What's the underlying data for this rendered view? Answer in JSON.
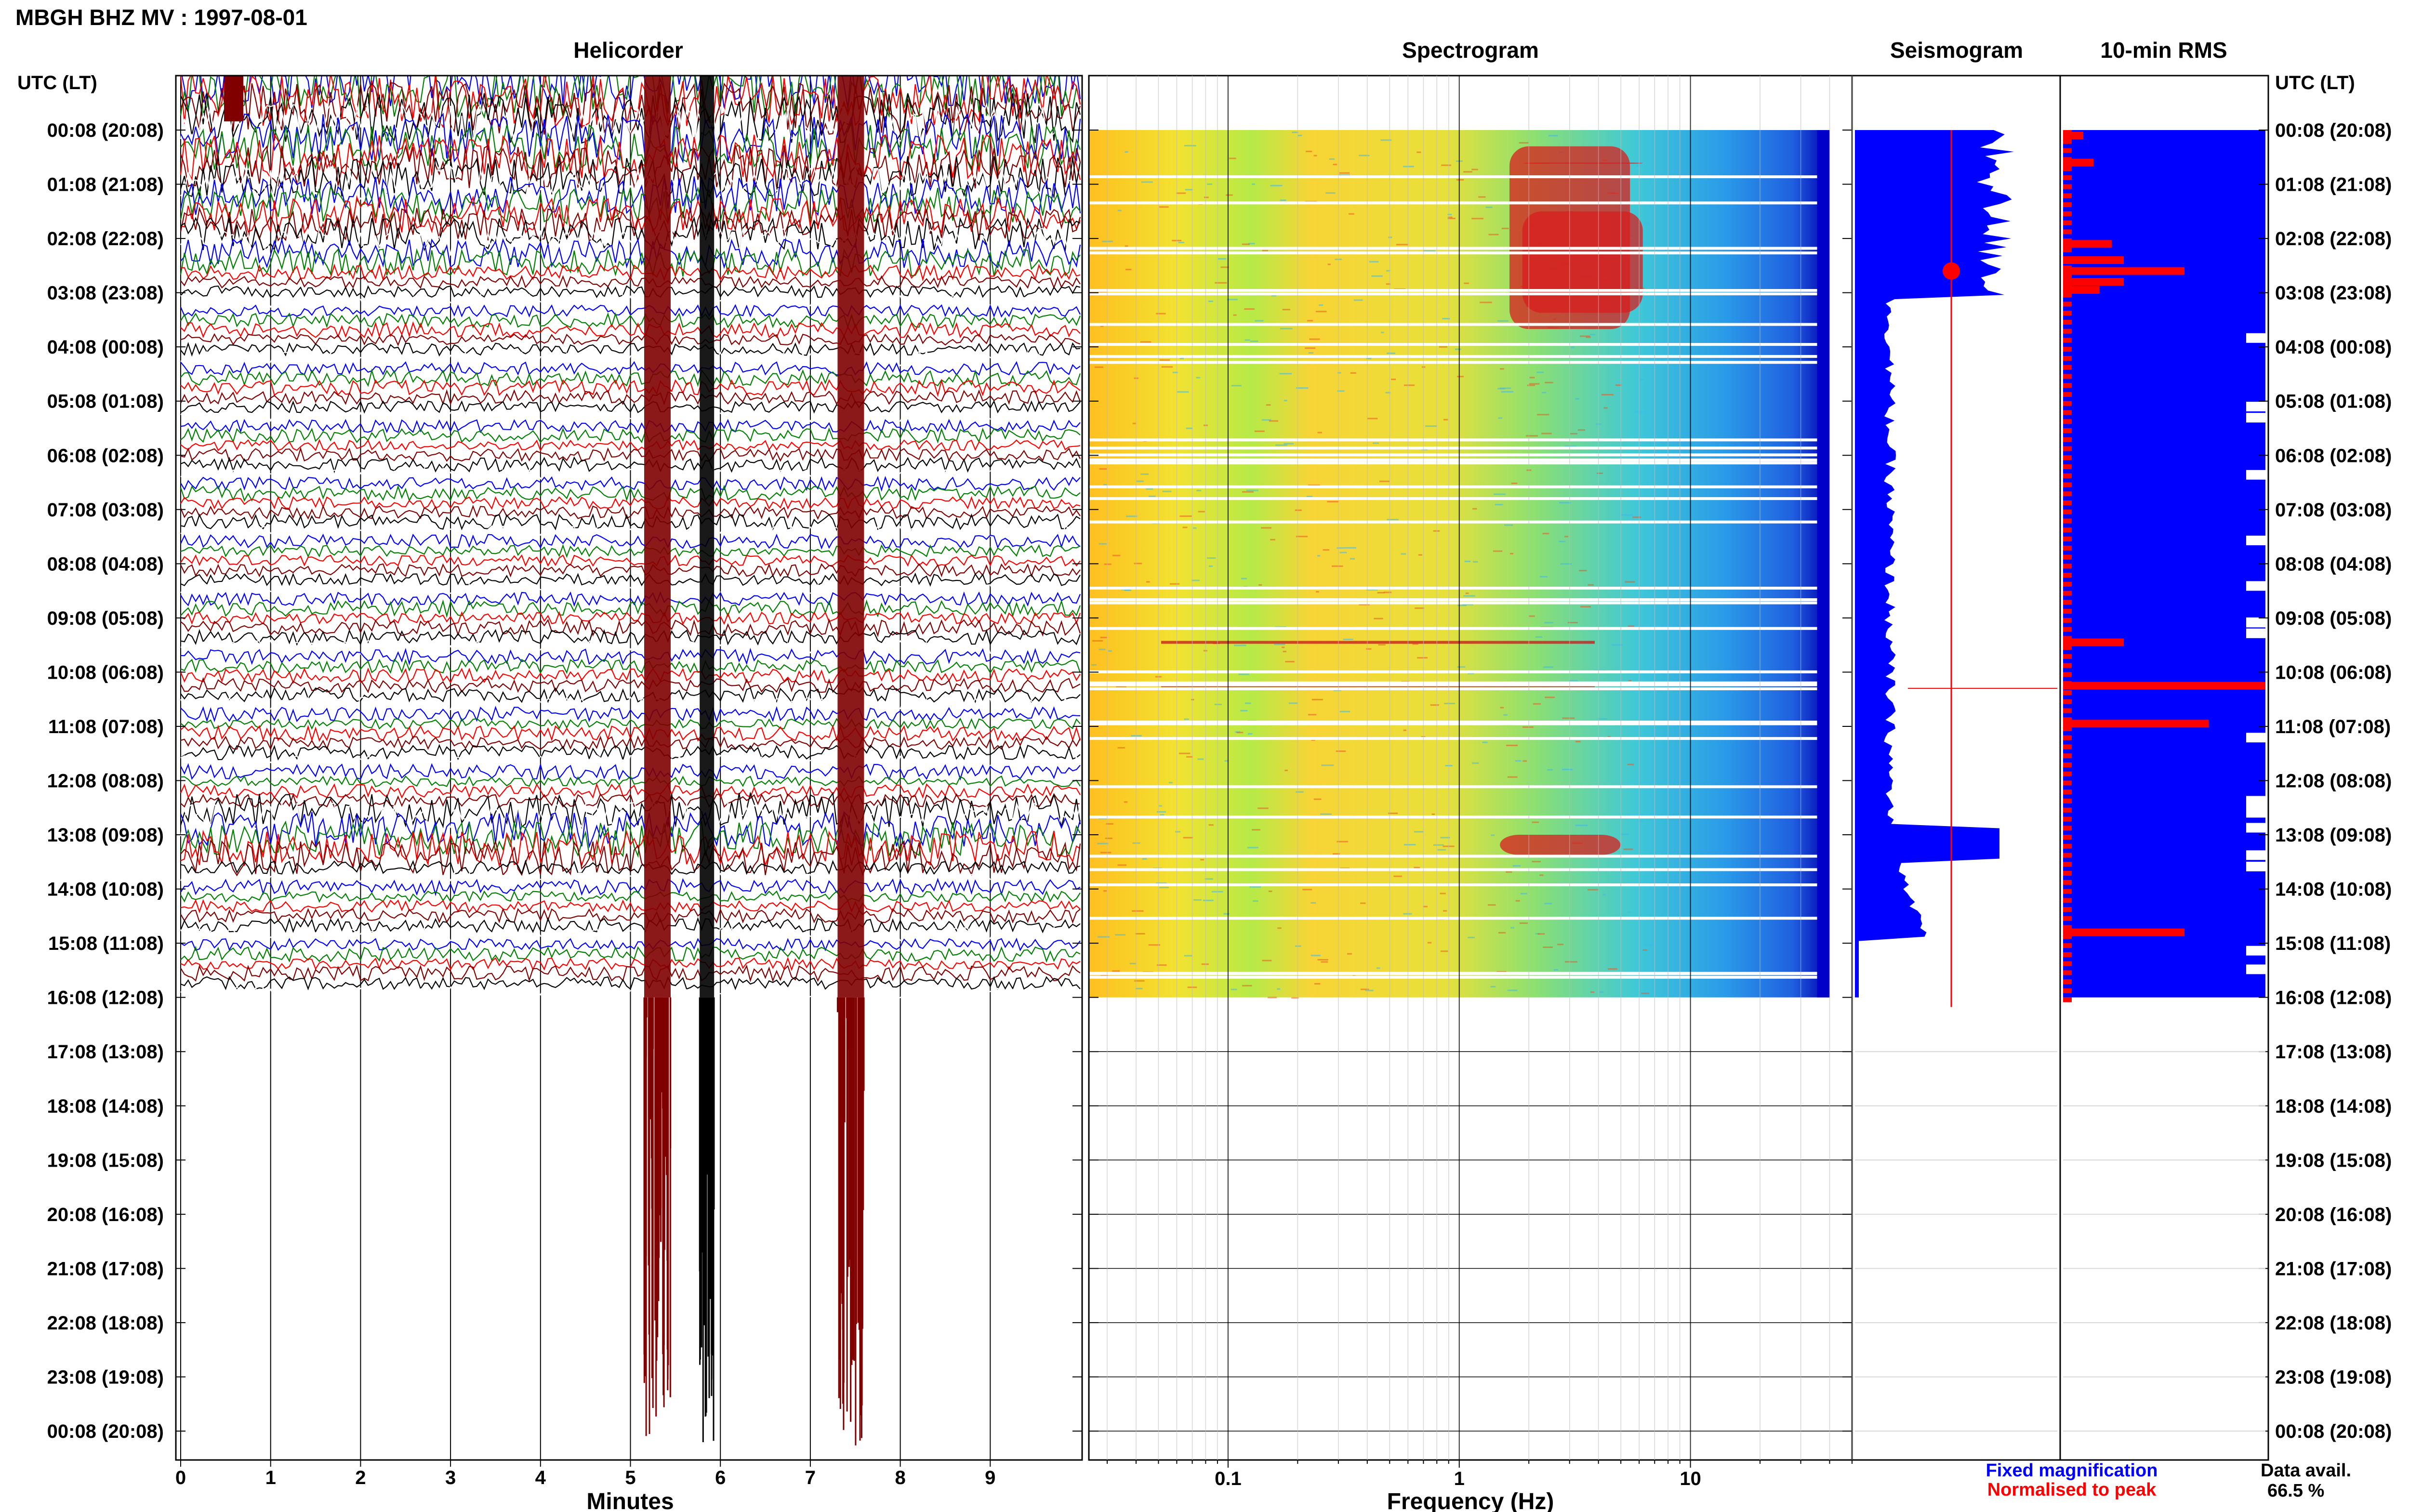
{
  "header": {
    "title": "MBGH BHZ MV : 1997-08-01",
    "time_axis_label": "UTC (LT)"
  },
  "panels": {
    "helicorder": "Helicorder",
    "spectrogram": "Spectrogram",
    "seismogram": "Seismogram",
    "rms": "10-min RMS"
  },
  "legend": {
    "fixed": "Fixed magnification",
    "normalised": "Normalised to peak",
    "fixed_color": "#0000ff",
    "normalised_color": "#ff0000",
    "data_avail_label": "Data avail.",
    "data_avail_value": "66.5 %"
  },
  "chart_data": {
    "type": "heatmap",
    "time_ticks": [
      "00:08 (20:08)",
      "01:08 (21:08)",
      "02:08 (22:08)",
      "03:08 (23:08)",
      "04:08 (00:08)",
      "05:08 (01:08)",
      "06:08 (02:08)",
      "07:08 (03:08)",
      "08:08 (04:08)",
      "09:08 (05:08)",
      "10:08 (06:08)",
      "11:08 (07:08)",
      "12:08 (08:08)",
      "13:08 (09:08)",
      "14:08 (10:08)",
      "15:08 (11:08)",
      "16:08 (12:08)",
      "17:08 (13:08)",
      "18:08 (14:08)",
      "19:08 (15:08)",
      "20:08 (16:08)",
      "21:08 (17:08)",
      "22:08 (18:08)",
      "23:08 (19:08)",
      "00:08 (20:08)"
    ],
    "data_end_hour": 16,
    "helicorder": {
      "xlabel": "Minutes",
      "xlim": [
        0,
        10
      ],
      "xticks": [
        0,
        1,
        2,
        3,
        4,
        5,
        6,
        7,
        8,
        9
      ],
      "trace_colors": [
        "#0000ff",
        "#007f00",
        "#ff0000",
        "#800000",
        "#000000",
        "#ffffff"
      ],
      "event_minutes": [
        5.3,
        5.85,
        7.45
      ]
    },
    "spectrogram": {
      "xlabel": "Frequency (Hz)",
      "xscale": "log",
      "xlim": [
        0.025,
        50
      ],
      "xticks": [
        0.1,
        1,
        10
      ],
      "xtick_labels": [
        "0.1",
        "1",
        "10"
      ],
      "data_fmax": 40
    },
    "rms": {
      "bars": [
        {
          "hour": 0.1,
          "value": 0.1
        },
        {
          "hour": 0.6,
          "value": 0.15
        },
        {
          "hour": 2.1,
          "value": 0.24
        },
        {
          "hour": 2.4,
          "value": 0.3
        },
        {
          "hour": 2.6,
          "value": 0.6
        },
        {
          "hour": 2.8,
          "value": 0.3
        },
        {
          "hour": 2.95,
          "value": 0.18
        },
        {
          "hour": 9.45,
          "value": 0.3
        },
        {
          "hour": 10.25,
          "value": 1.0
        },
        {
          "hour": 10.95,
          "value": 0.72
        },
        {
          "hour": 14.8,
          "value": 0.6
        }
      ]
    }
  }
}
